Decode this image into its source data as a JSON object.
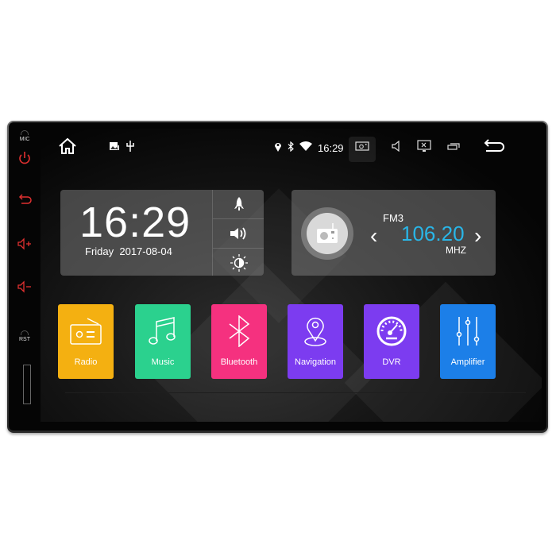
{
  "hardware": {
    "mic_label": "MIC",
    "rst_label": "RST",
    "hardkeys": [
      "power-icon",
      "back-icon",
      "volume-up-icon",
      "volume-down-icon"
    ],
    "hardkey_color": "#e03030"
  },
  "statusbar": {
    "left_icons": [
      "home-icon",
      "gallery-icon",
      "usb-icon"
    ],
    "indicators": [
      "location-icon",
      "bluetooth-icon",
      "wifi-icon"
    ],
    "time": "16:29",
    "right_icons": [
      "screenshot-icon",
      "volume-icon",
      "screen-off-icon",
      "recent-apps-icon",
      "back-icon"
    ]
  },
  "clock_widget": {
    "time": "16:29",
    "day": "Friday",
    "date": "2017-08-04",
    "quick_actions": [
      "rocket-icon",
      "volume-icon",
      "brightness-icon"
    ]
  },
  "radio_widget": {
    "band": "FM3",
    "frequency": "106.20",
    "unit": "MHZ",
    "prev_label": "‹",
    "next_label": "›",
    "freq_color": "#29b6e8"
  },
  "apps": [
    {
      "label": "Radio",
      "icon": "radio-icon",
      "color": "#f4b011"
    },
    {
      "label": "Music",
      "icon": "music-note-icon",
      "color": "#2bd18e"
    },
    {
      "label": "Bluetooth",
      "icon": "bluetooth-icon",
      "color": "#f5317f"
    },
    {
      "label": "Navigation",
      "icon": "map-pin-icon",
      "color": "#7c3cf0"
    },
    {
      "label": "DVR",
      "icon": "speedometer-icon",
      "color": "#7c3cf0"
    },
    {
      "label": "Amplifier",
      "icon": "equalizer-icon",
      "color": "#1c7fe8"
    }
  ]
}
